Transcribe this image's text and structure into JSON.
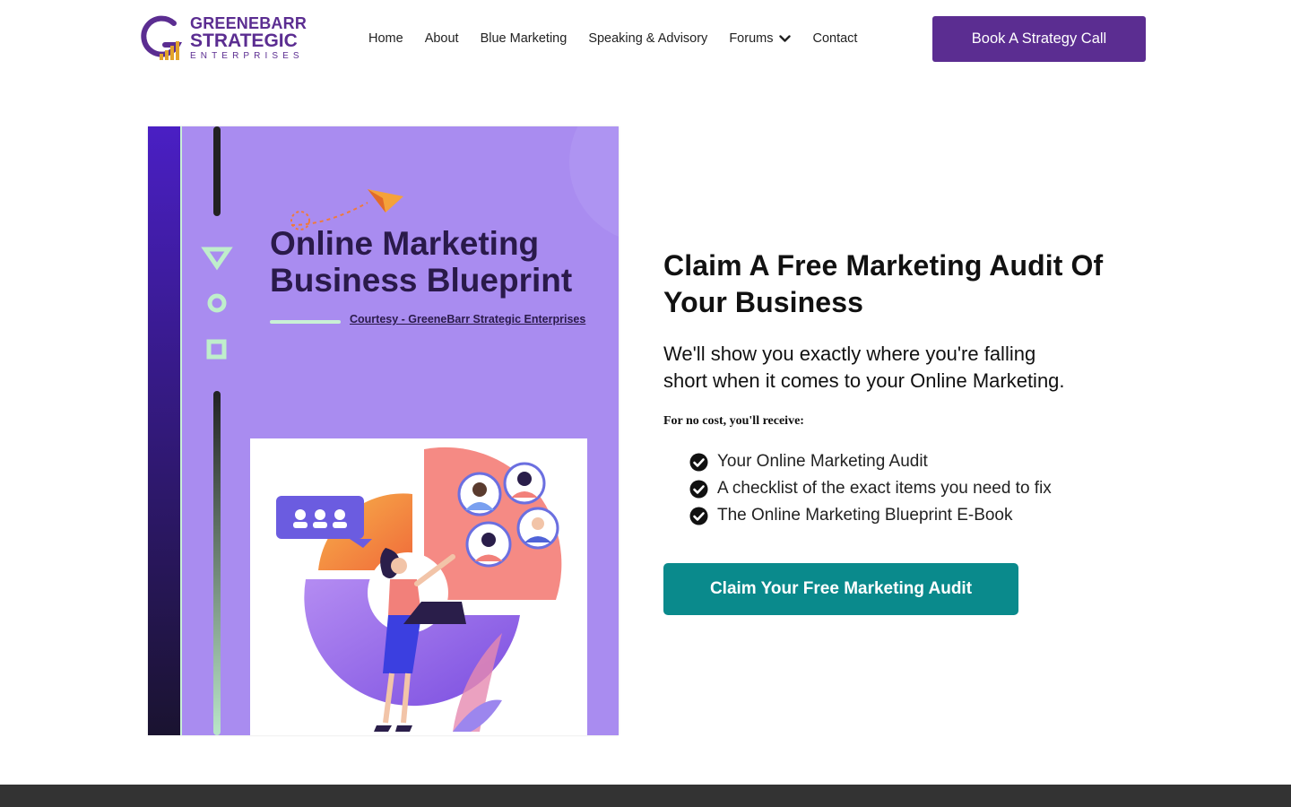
{
  "brand": {
    "line1": "GREENEBARR",
    "line2": "STRATEGIC",
    "line3": "ENTERPRISES",
    "primary_color": "#5b2d91",
    "accent_color": "#e2a32a"
  },
  "nav": {
    "items": [
      {
        "label": "Home"
      },
      {
        "label": "About"
      },
      {
        "label": "Blue Marketing"
      },
      {
        "label": "Speaking & Advisory"
      },
      {
        "label": "Forums",
        "has_dropdown": true
      },
      {
        "label": "Contact"
      }
    ],
    "cta_label": "Book A Strategy Call"
  },
  "hero_image": {
    "title_line1": "Online Marketing",
    "title_line2": "Business Blueprint",
    "courtesy": "Courtesy - GreeneBarr Strategic Enterprises",
    "bg_color": "#a98cf0"
  },
  "main": {
    "headline_line1": "Claim A Free Marketing Audit Of",
    "headline_line2": "Your Business",
    "subhead_line1": "We'll show you exactly where you're falling",
    "subhead_line2": "short when it comes to your Online Marketing.",
    "receive_label": "For no cost, you'll receive:",
    "checklist": [
      "Your Online Marketing Audit",
      "A checklist of the exact items you need to fix",
      "The Online Marketing Blueprint E-Book"
    ],
    "cta_label": "Claim Your Free Marketing Audit",
    "cta_color": "#0a8a8c"
  },
  "icons": {
    "check": "check-circle-icon",
    "chevron": "chevron-down-icon"
  }
}
